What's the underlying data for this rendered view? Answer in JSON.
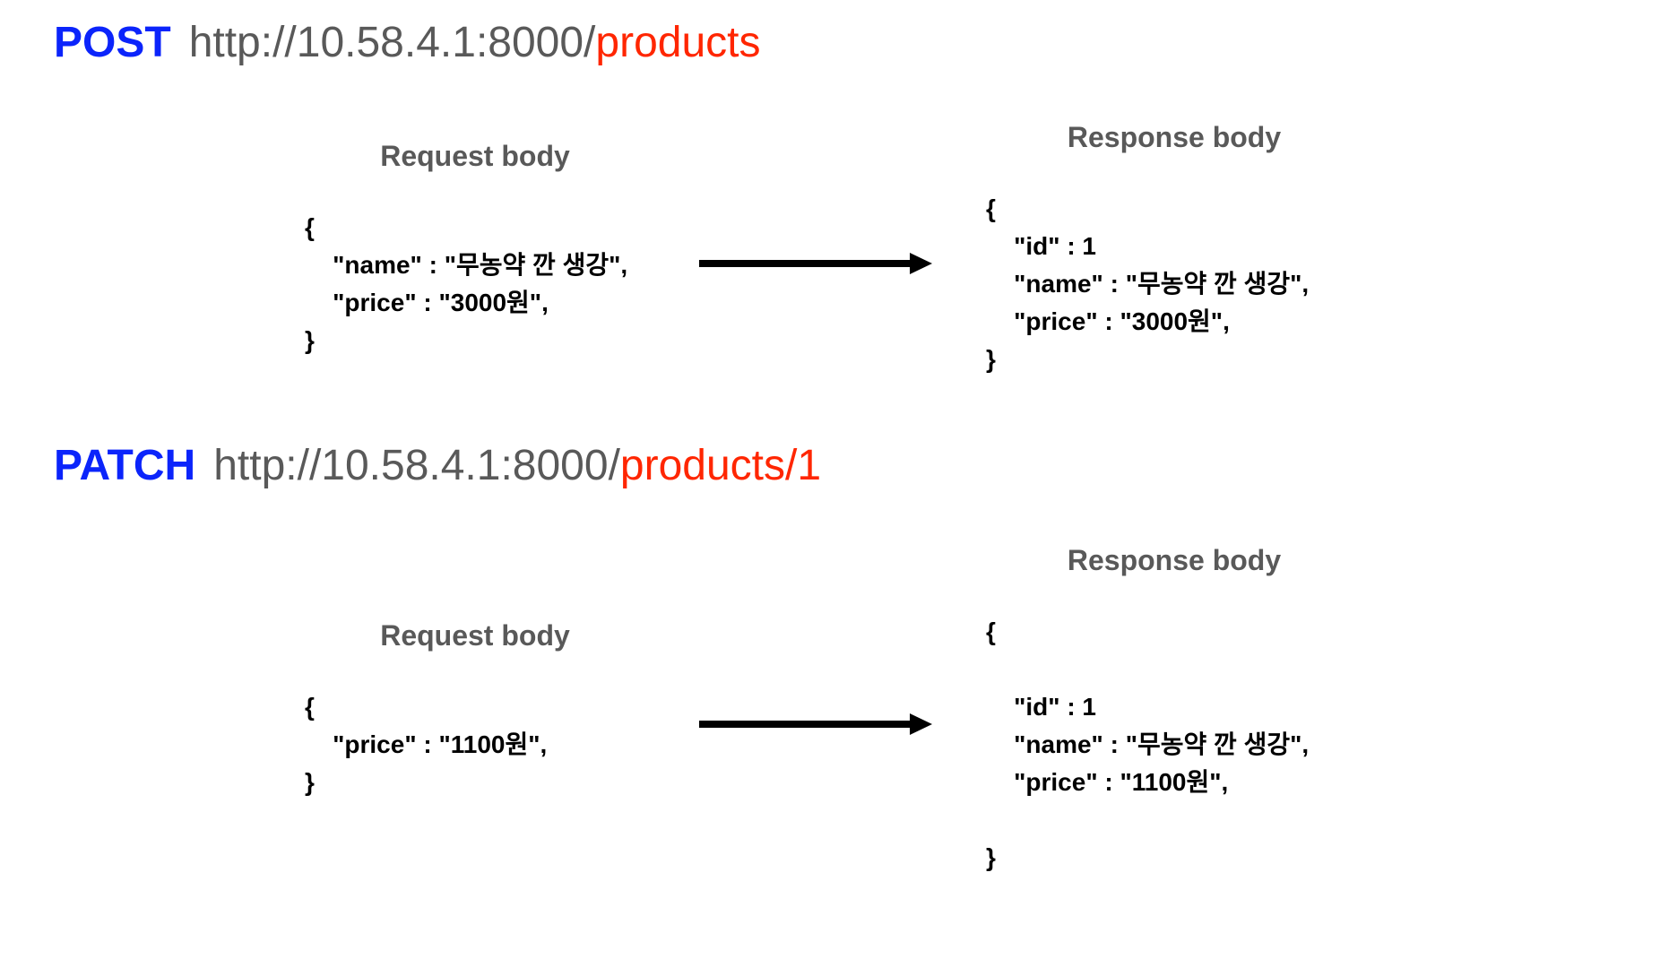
{
  "post": {
    "method": "POST",
    "url_base": "http://10.58.4.1:8000/",
    "url_path": "products",
    "request_label": "Request body",
    "response_label": "Response body",
    "request_body": "{\n    \"name\" : \"무농약 깐 생강\",\n    \"price\" : \"3000원\",\n}",
    "response_body": "{\n    \"id\" : 1\n    \"name\" : \"무농약 깐 생강\",\n    \"price\" : \"3000원\",\n}"
  },
  "patch": {
    "method": "PATCH",
    "url_base": "http://10.58.4.1:8000/",
    "url_path": "products/1",
    "request_label": "Request body",
    "response_label": "Response body",
    "request_body": "{\n    \"price\" : \"1100원\",\n}",
    "response_body": "{\n\n    \"id\" : 1\n    \"name\" : \"무농약 깐 생강\",\n    \"price\" : \"1100원\",\n\n}"
  }
}
